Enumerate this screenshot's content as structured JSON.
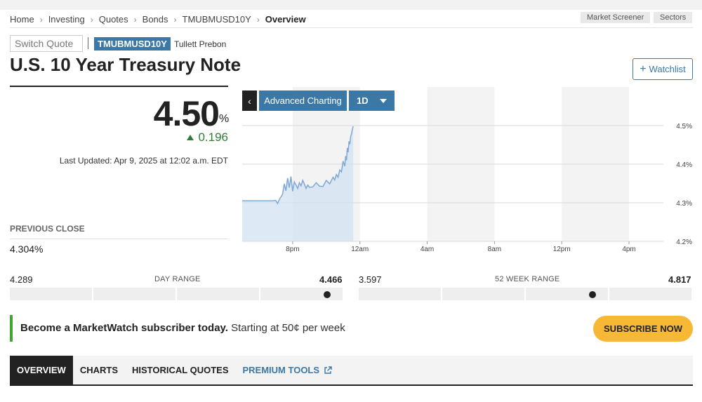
{
  "breadcrumb": [
    "Home",
    "Investing",
    "Quotes",
    "Bonds",
    "TMUBMUSD10Y",
    "Overview"
  ],
  "header_links": {
    "market_screener": "Market Screener",
    "sectors": "Sectors"
  },
  "quote": {
    "switch_placeholder": "Switch Quote",
    "ticker": "TMUBMUSD10Y",
    "source": "Tullett Prebon",
    "title": "U.S. 10 Year Treasury Note",
    "watchlist_label": "Watchlist",
    "price": "4.50",
    "price_unit": "%",
    "change": "0.196",
    "change_direction": "up",
    "last_updated": "Last Updated: Apr 9, 2025 at 12:02 a.m. EDT",
    "previous_close_label": "PREVIOUS CLOSE",
    "previous_close": "4.304%"
  },
  "chart_controls": {
    "advanced": "Advanced Charting",
    "interval": "1D"
  },
  "chart_data": {
    "type": "area",
    "x_ticks": [
      "8pm",
      "12am",
      "4am",
      "8am",
      "12pm",
      "4pm"
    ],
    "y_ticks": [
      "4.5%",
      "4.4%",
      "4.3%",
      "4.2%"
    ],
    "ylim": [
      4.2,
      4.5
    ],
    "x_domain_hours": [
      -3,
      21
    ],
    "grid": true,
    "y_axis_side": "right",
    "series": [
      {
        "color": "#7fa8d6",
        "x": [
          -3.0,
          -2.5,
          -2.0,
          -1.5,
          -1.2,
          -1.0,
          -0.9,
          -0.8,
          -0.6,
          -0.5,
          -0.4,
          -0.3,
          -0.2,
          -0.1,
          0.0,
          0.1,
          0.2,
          0.3,
          0.4,
          0.5,
          0.6,
          0.7,
          0.8,
          0.9,
          1.0,
          1.2,
          1.4,
          1.6,
          1.8,
          2.0,
          2.2,
          2.4,
          2.5,
          2.6,
          2.7,
          2.8,
          2.9,
          3.0,
          3.1,
          3.15,
          3.2,
          3.25,
          3.3,
          3.35,
          3.4,
          3.45,
          3.5,
          3.55,
          3.6
        ],
        "values": [
          4.305,
          4.305,
          4.305,
          4.305,
          4.305,
          4.306,
          4.298,
          4.308,
          4.322,
          4.349,
          4.331,
          4.364,
          4.339,
          4.368,
          4.33,
          4.354,
          4.346,
          4.337,
          4.352,
          4.344,
          4.358,
          4.348,
          4.337,
          4.346,
          4.34,
          4.341,
          4.352,
          4.343,
          4.342,
          4.358,
          4.349,
          4.366,
          4.359,
          4.373,
          4.366,
          4.385,
          4.38,
          4.408,
          4.395,
          4.421,
          4.41,
          4.442,
          4.431,
          4.459,
          4.452,
          4.472,
          4.479,
          4.49,
          4.498
        ]
      }
    ]
  },
  "day_range": {
    "low": "4.289",
    "high": "4.466",
    "label": "DAY RANGE",
    "position": 0.95
  },
  "week52_range": {
    "low": "3.597",
    "high": "4.817",
    "label": "52 WEEK RANGE",
    "position": 0.7
  },
  "promo": {
    "headline": "Become a MarketWatch subscriber today.",
    "sub": " Starting at 50¢ per week",
    "button": "SUBSCRIBE NOW"
  },
  "tabs": [
    {
      "label": "OVERVIEW"
    },
    {
      "label": "CHARTS"
    },
    {
      "label": "HISTORICAL QUOTES"
    },
    {
      "label": "PREMIUM TOOLS"
    }
  ]
}
